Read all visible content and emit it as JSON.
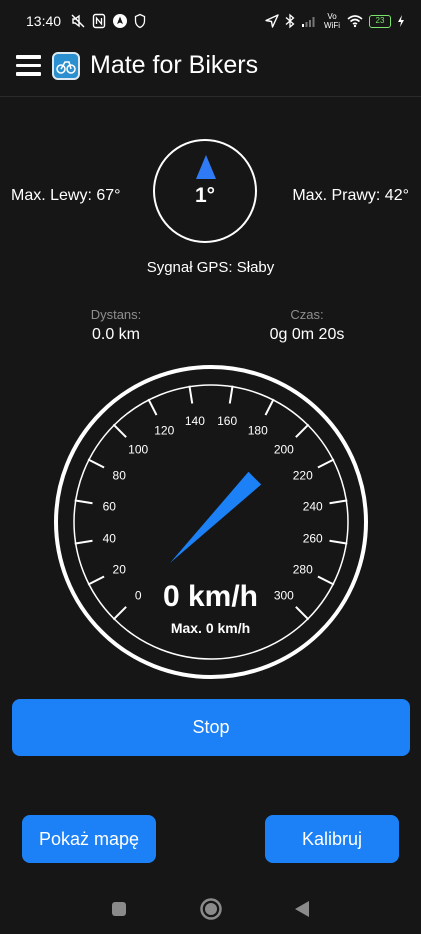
{
  "status_bar": {
    "time": "13:40",
    "battery": "23",
    "network_label": "Vo WiFi",
    "icons": [
      "mute-icon",
      "nfc-icon",
      "navigation-app-icon",
      "secure-icon",
      "location-icon",
      "bluetooth-icon",
      "signal-icon",
      "wifi-icon",
      "battery-icon",
      "charging-icon"
    ]
  },
  "app_bar": {
    "title": "Mate for Bikers"
  },
  "lean": {
    "current": "1°",
    "max_left": "Max. Lewy: 67°",
    "max_right": "Max. Prawy: 42°"
  },
  "gps_status": "Sygnał GPS: Słaby",
  "stats": {
    "distance_label": "Dystans:",
    "distance_value": "0.0 km",
    "time_label": "Czas:",
    "time_value": "0g 0m 20s"
  },
  "speedometer": {
    "speed_text": "0 km/h",
    "max_text": "Max. 0 km/h",
    "scale_labels": [
      "0",
      "20",
      "40",
      "60",
      "80",
      "100",
      "120",
      "140",
      "160",
      "180",
      "200",
      "220",
      "240",
      "260",
      "280",
      "300"
    ],
    "accent_color": "#1c80f7"
  },
  "buttons": {
    "stop": "Stop",
    "show_map": "Pokaż mapę",
    "calibrate": "Kalibruj"
  },
  "colors": {
    "background": "#161616",
    "accent": "#1c80f7",
    "muted_text": "#8e8e8e"
  }
}
